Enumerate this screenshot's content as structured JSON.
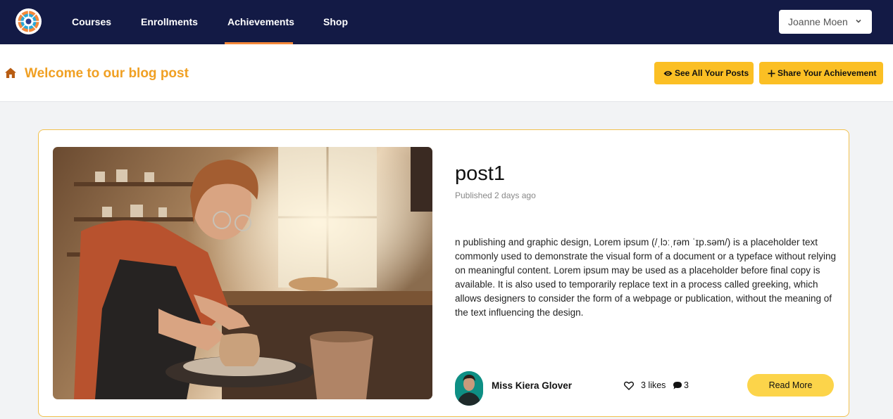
{
  "nav": {
    "items": [
      {
        "label": "Courses"
      },
      {
        "label": "Enrollments"
      },
      {
        "label": "Achievements",
        "active": true
      },
      {
        "label": "Shop"
      }
    ],
    "user_name": "Joanne Moen"
  },
  "header": {
    "title": "Welcome to our blog post",
    "see_posts_label": "See All Your Posts",
    "share_label": "Share Your Achievement"
  },
  "post": {
    "title": "post1",
    "published": "Published 2 days ago",
    "body": "n publishing and graphic design, Lorem ipsum (/ˌlɔːˌrəm ˈɪp.səm/) is a placeholder text commonly used to demonstrate the visual form of a document or a typeface without relying on meaningful content. Lorem ipsum may be used as a placeholder before final copy is available. It is also used to temporarily replace text in a process called greeking, which allows designers to consider the form of a webpage or publication, without the meaning of the text influencing the design.",
    "author": "Miss Kiera Glover",
    "likes": "3 likes",
    "comments": "3",
    "read_more_label": "Read More"
  },
  "colors": {
    "nav_bg": "#131a45",
    "accent_orange": "#f0a023",
    "button_yellow": "#fbbf24",
    "active_underline": "#f5883a"
  },
  "icons": [
    "logo-icon",
    "chevron-down-icon",
    "home-icon",
    "eye-icon",
    "plus-icon",
    "heart-icon",
    "comment-icon"
  ]
}
